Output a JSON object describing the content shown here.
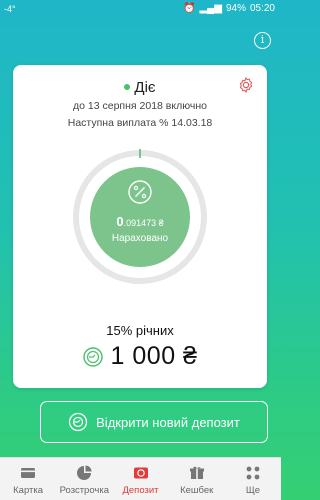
{
  "status_bar": {
    "left": "-4°",
    "battery": "94%",
    "time": "05:20"
  },
  "deposit": {
    "status": "Діє",
    "until": "до 13 серпня 2018 включно",
    "next_payment": "Наступна виплата % 14.03.18",
    "accrued_int": "0",
    "accrued_frac": ".091473 ₴",
    "accrued_label": "Нараховано",
    "rate": "15% річних",
    "amount": "1 000 ₴"
  },
  "actions": {
    "open_new": "Відкрити новий депозит"
  },
  "tabs": [
    {
      "label": "Картка",
      "icon": "card-icon"
    },
    {
      "label": "Розстрочка",
      "icon": "pie-icon"
    },
    {
      "label": "Депозит",
      "icon": "deposit-icon"
    },
    {
      "label": "Кешбек",
      "icon": "gift-icon"
    },
    {
      "label": "Ще",
      "icon": "more-icon"
    }
  ],
  "colors": {
    "accent": "#e23b3b",
    "gauge_fill": "#7cc48c",
    "status_dot": "#4bbf6b"
  }
}
